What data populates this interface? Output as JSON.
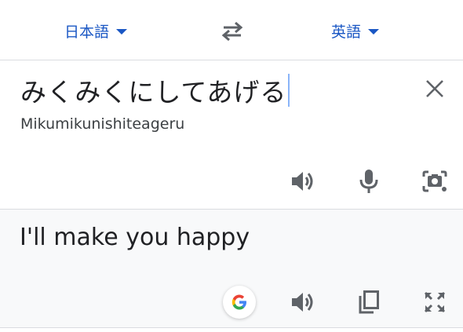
{
  "colors": {
    "accent": "#1a57c4",
    "icon": "#5f6368",
    "text": "#202124",
    "result_background": "#f8f9fa"
  },
  "language_bar": {
    "source_language": "日本語",
    "target_language": "英語",
    "swap_icon": "swap-arrows-icon",
    "dropdown_icon": "caret-down-icon"
  },
  "source": {
    "text": "みくみくにしてあげる",
    "romanization": "Mikumikunishiteageru",
    "clear_icon": "close-icon",
    "actions": [
      "speaker-icon",
      "microphone-icon",
      "camera-icon"
    ]
  },
  "result": {
    "text": "I'll make you happy",
    "actions": [
      "google-icon",
      "speaker-icon",
      "copy-icon",
      "fullscreen-icon"
    ]
  }
}
